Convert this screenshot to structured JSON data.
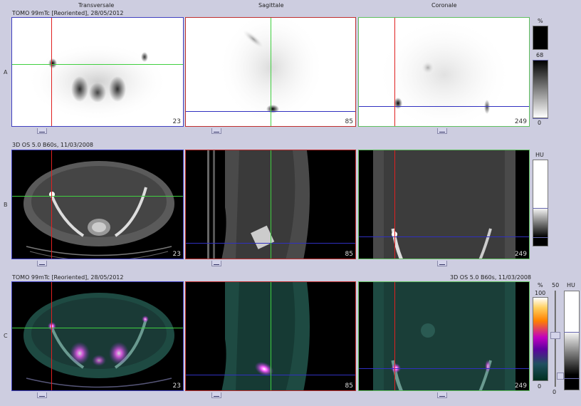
{
  "headers": {
    "transversal": "Transversale",
    "sagittal": "Sagittale",
    "coronal": "Coronale"
  },
  "rows": {
    "a": {
      "letter": "A",
      "title": "TOMO 99mTc [Reoriented], 28/05/2012",
      "slices": [
        "23",
        "85",
        "249"
      ],
      "colorbar": {
        "unit": "%",
        "top": "68",
        "bottom": "0"
      }
    },
    "b": {
      "letter": "B",
      "title": "3D OS 5.0 B60s, 11/03/2008",
      "slices": [
        "23",
        "85",
        "249"
      ],
      "colorbar": {
        "unit": "HU"
      }
    },
    "c": {
      "letter": "C",
      "title_left": "TOMO 99mTc [Reoriented], 28/05/2012",
      "title_right": "3D OS 5.0 B60s, 11/03/2008",
      "slices": [
        "23",
        "85",
        "249"
      ],
      "colorbar_pet": {
        "unit": "%",
        "top": "100",
        "bottom": "0"
      },
      "slider": {
        "top": "50",
        "bottom": "0"
      },
      "colorbar_ct": {
        "unit": "HU"
      }
    }
  },
  "colors": {
    "background": "#cdcde0",
    "transversal_frame": "#4040c0",
    "sagittal_frame": "#c03030",
    "coronal_frame": "#60c060",
    "crosshair_red": "#e02020",
    "crosshair_green": "#40d040",
    "crosshair_blue": "#3030c0"
  }
}
